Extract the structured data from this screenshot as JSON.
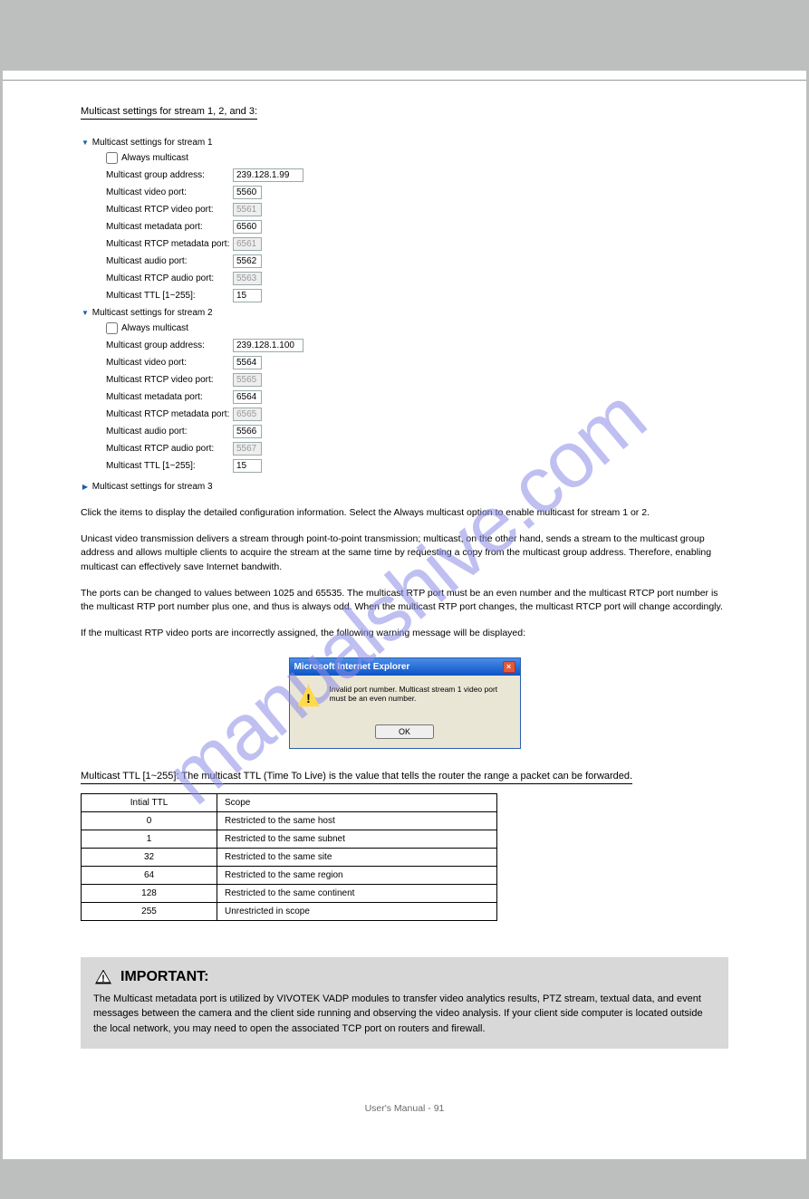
{
  "watermark": "manualshive.com",
  "sectionTitle": "Multicast settings for stream 1, 2, and 3:",
  "s1Head": "Multicast settings for stream 1",
  "s2Head": "Multicast settings for stream 2",
  "s3Head": "Multicast settings for stream 3",
  "alwaysLabel": "Always multicast",
  "labels": {
    "group": "Multicast group address:",
    "video": "Multicast video port:",
    "rtcpVideo": "Multicast RTCP video port:",
    "meta": "Multicast metadata port:",
    "rtcpMeta": "Multicast RTCP metadata port:",
    "audio": "Multicast audio port:",
    "rtcpAudio": "Multicast RTCP audio port:",
    "ttl": "Multicast TTL [1~255]:"
  },
  "s1": {
    "group": "239.128.1.99",
    "video": "5560",
    "rtcpVideo": "5561",
    "meta": "6560",
    "rtcpMeta": "6561",
    "audio": "5562",
    "rtcpAudio": "5563",
    "ttl": "15"
  },
  "s2": {
    "group": "239.128.1.100",
    "video": "5564",
    "rtcpVideo": "5565",
    "meta": "6564",
    "rtcpMeta": "6565",
    "audio": "5566",
    "rtcpAudio": "5567",
    "ttl": "15"
  },
  "para1a": "Click the items to display the detailed configuration information. Select the Always multicast option to enable multicast for stream 1 or 2.",
  "para2": "Unicast video transmission delivers a stream through point-to-point transmission; multicast, on the other hand, sends a stream to the multicast group address and allows multiple clients to acquire the stream at the same time by requesting a copy from the multicast group address. Therefore, enabling multicast can effectively save Internet bandwith.",
  "para3": "The ports can be changed to values between 1025 and 65535. The multicast RTP port must be an even number and the multicast RTCP port number is the multicast RTP port number plus one, and thus is always odd. When the multicast RTP port changes, the multicast RTCP port will change accordingly.",
  "para4": "If the multicast RTP video ports are incorrectly assigned, the following warning message will be displayed:",
  "dialogTitle": "Microsoft Internet Explorer",
  "dialogMsg": "Invalid port number. Multicast stream 1 video port must be an even number.",
  "ok": "OK",
  "rtspHead": "Multicast TTL [1~255]: The multicast TTL (Time To Live) is the value that tells the router the range a packet can be forwarded.",
  "table": {
    "h1": "Intial TTL",
    "h2": "Scope",
    "r": [
      [
        "0",
        "Restricted to the same host"
      ],
      [
        "1",
        "Restricted to the same subnet"
      ],
      [
        "32",
        "Restricted to the same site"
      ],
      [
        "64",
        "Restricted to the same region"
      ],
      [
        "128",
        "Restricted to the same continent"
      ],
      [
        "255",
        "Unrestricted in scope"
      ]
    ]
  },
  "cautionTitle": "IMPORTANT:",
  "cautionBody": "The Multicast metadata port is utilized by VIVOTEK VADP modules to transfer video analytics results, PTZ stream, textual data, and event messages between the camera and the client side running and observing the video analysis. If your client side computer is located outside the local network, you may need to open the associated TCP port on routers and firewall.",
  "footer": "User's Manual - 91"
}
